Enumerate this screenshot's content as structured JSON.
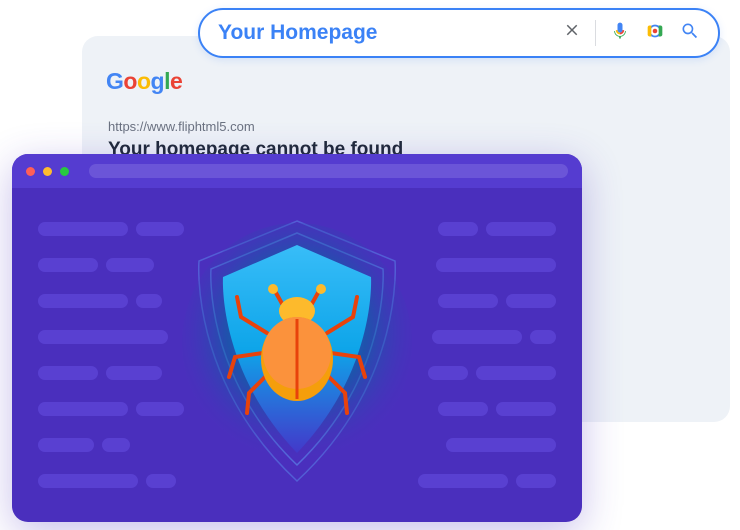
{
  "search": {
    "query": "Your Homepage",
    "placeholder": "Search"
  },
  "logo": {
    "letters": [
      "G",
      "o",
      "o",
      "g",
      "l",
      "e"
    ]
  },
  "result": {
    "url": "https://www.fliphtml5.com",
    "title": "Your homepage cannot be found"
  },
  "icons": {
    "close_semantic": "close",
    "mic_semantic": "microphone",
    "lens_semantic": "camera-lens",
    "search_semantic": "search",
    "shield_semantic": "shield",
    "bug_semantic": "bug"
  }
}
